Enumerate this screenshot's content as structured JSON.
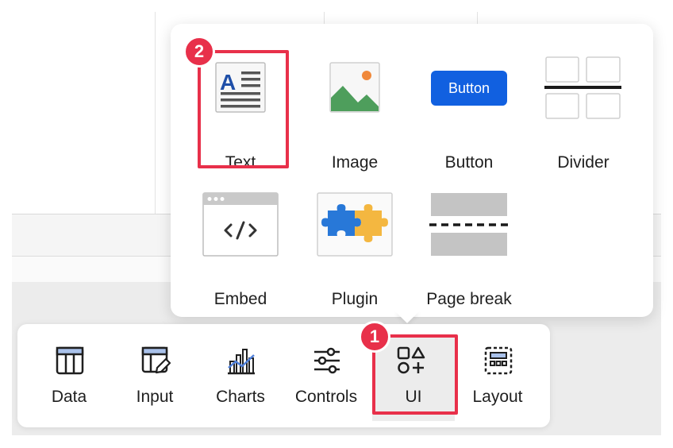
{
  "popover": {
    "elements": [
      {
        "label": "Text",
        "icon": "text-block-icon"
      },
      {
        "label": "Image",
        "icon": "image-icon"
      },
      {
        "label": "Button",
        "icon": "button-icon",
        "preview_text": "Button"
      },
      {
        "label": "Divider",
        "icon": "divider-icon"
      },
      {
        "label": "Embed",
        "icon": "embed-icon"
      },
      {
        "label": "Plugin",
        "icon": "puzzle-icon"
      },
      {
        "label": "Page break",
        "icon": "page-break-icon"
      }
    ]
  },
  "toolbar": {
    "items": [
      {
        "label": "Data",
        "icon": "table-icon"
      },
      {
        "label": "Input",
        "icon": "input-table-icon"
      },
      {
        "label": "Charts",
        "icon": "chart-icon"
      },
      {
        "label": "Controls",
        "icon": "sliders-icon"
      },
      {
        "label": "UI",
        "icon": "shapes-icon",
        "active": true
      },
      {
        "label": "Layout",
        "icon": "layout-icon"
      }
    ]
  },
  "callouts": {
    "step1": "1",
    "step2": "2"
  },
  "colors": {
    "accent_red": "#e8304a",
    "button_blue": "#1160e0",
    "text_blue": "#1f4fa8",
    "image_green": "#4e9e5c",
    "image_sun": "#f0883a",
    "puzzle_blue": "#2878d8",
    "puzzle_yellow": "#f4b740"
  }
}
